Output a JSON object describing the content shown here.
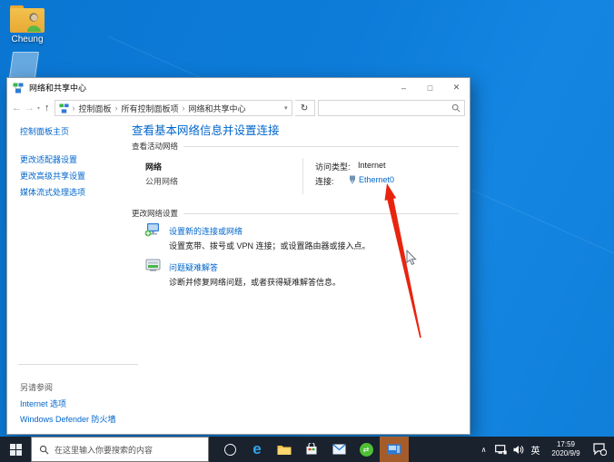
{
  "desktop": {
    "user_icon_label": "Cheung"
  },
  "icons": {
    "minimize": "–",
    "maximize": "□",
    "close": "✕",
    "back": "←",
    "forward": "→",
    "up": "↑",
    "refresh": "↻",
    "dropdown": "▾",
    "crumb_sep": "›",
    "edge": "e",
    "green_app": "⇄",
    "tray_chevron": "∧"
  },
  "window": {
    "title": "网络和共享中心",
    "breadcrumb": [
      "控制面板",
      "所有控制面板项",
      "网络和共享中心"
    ],
    "sidebar": {
      "home": "控制面板主页",
      "links": [
        "更改适配器设置",
        "更改高级共享设置",
        "媒体流式处理选项"
      ],
      "see_also": "另请参阅",
      "see_also_links": [
        "Internet 选项",
        "Windows Defender 防火墙"
      ]
    },
    "main": {
      "heading": "查看基本网络信息并设置连接",
      "sections": {
        "active": "查看活动网络",
        "change": "更改网络设置"
      },
      "network": {
        "name": "网络",
        "profile": "公用网络"
      },
      "access": {
        "label": "访问类型:",
        "value": "Internet"
      },
      "connection": {
        "label": "连接:",
        "value": "Ethernet0"
      },
      "tasks": [
        {
          "title": "设置新的连接或网络",
          "desc": "设置宽带、拨号或 VPN 连接；或设置路由器或接入点。"
        },
        {
          "title": "问题疑难解答",
          "desc": "诊断并修复网络问题，或者获得疑难解答信息。"
        }
      ]
    }
  },
  "taskbar": {
    "search_placeholder": "在这里输入你要搜索的内容",
    "tray": {
      "ime": "英",
      "time": "17:59",
      "date": "2020/9/9"
    }
  },
  "colors": {
    "link": "#0066cc",
    "desktop_blue": "#0d7cd9",
    "arrow_red": "#e8240f",
    "taskbar": "#1a222e"
  }
}
